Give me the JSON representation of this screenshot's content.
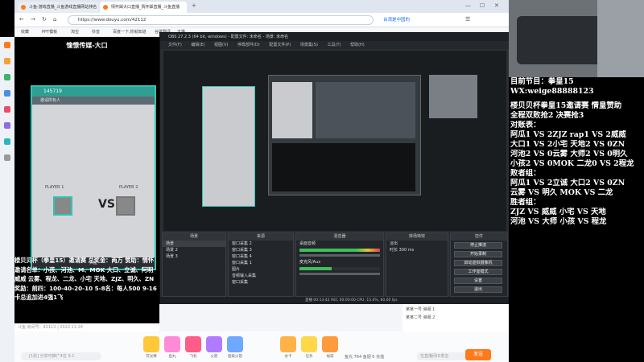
{
  "browser": {
    "tabs": [
      {
        "title": "斗鱼-游戏直播_斗鱼游戏直播网站排名"
      },
      {
        "title": "情怀踩大口直播_情怀踩直播_斗鱼直播"
      }
    ],
    "url": "https://www.douyu.com/42112",
    "security_text": "台湾是中国的",
    "bookmarks": [
      "收藏",
      "PPT模板",
      "淘宝",
      "抖音",
      "百度一下,你就知道",
      "谷歌翻译",
      "天猫"
    ]
  },
  "stream": {
    "title": "憧憬传媒-大口",
    "room_id": "145719",
    "room_sub": "邀请所有人",
    "player1": "PLAYER 1",
    "player2": "PLAYER 2",
    "vs": "VS",
    "footer": "入座",
    "overlay_lines": [
      "楼贝贝杯（拳皇15）邀请赛 总奖金：两万 赞助：情怀",
      "邀请名单：小孩、河池、M、MOK 大口、立诚、阿明",
      "威威 云雾、程龙、二龙、小宅 天地、ZJZ、明久、ZN",
      "奖励：前四：100-40-20-10 5-8名：每人500 9-16",
      "卡总追加进4强1飞"
    ],
    "info": "斗鱼 房间号：42112 | 2022.11.24"
  },
  "obs": {
    "title": "OBS 27.2.3 (64 bit, windows) - 配置文件: 未命名 - 场景: 未命名",
    "menu": [
      "文件(F)",
      "编辑(E)",
      "视图(V)",
      "停靠部件(D)",
      "配置文件(P)",
      "场景集(S)",
      "工具(T)",
      "帮助(H)"
    ],
    "columns": {
      "scenes": {
        "header": "场景",
        "items": [
          "场景",
          "场景 2",
          "场景 3"
        ]
      },
      "sources": {
        "header": "来源",
        "items": [
          "窗口采集 2",
          "窗口采集 3",
          "窗口采集 4",
          "窗口采集 1",
          "图片",
          "音频输入采集",
          "窗口采集"
        ]
      },
      "mixer": {
        "header": "混音器",
        "items": [
          "桌面音频",
          "麦克风/Aux"
        ]
      },
      "transitions": {
        "header": "转场特效",
        "items": [
          "淡出",
          "时长 300 ms"
        ]
      },
      "controls": {
        "header": "控件",
        "buttons": [
          "停止推流",
          "开始录制",
          "启动虚拟摄像机",
          "工作室模式",
          "设置",
          "退出"
        ]
      }
    },
    "source_bar": "来源筛选",
    "status": "直播 00:13:42   REC 00:00:00   CPU: 15.0%, 60.00 fps"
  },
  "giftbar": {
    "chat_placeholder": "[1张] 分享可推广4位 9.1",
    "send": "发送",
    "chat_hint": "在直播间ID…",
    "gifts": [
      "荧光棒",
      "鱼丸",
      "飞机",
      "火箭",
      "超级火箭",
      "办卡",
      "任务",
      "福袋"
    ],
    "balance": "鱼丸 764  鱼翅 0 充值"
  },
  "chat": {
    "lines": [
      "某某一号 弹幕 1",
      "某某二号 弹幕 2"
    ],
    "input_hint": "在直播间ID发言"
  },
  "right": {
    "lines": [
      "目前节目：拳皇15",
      "WX:weige88888123",
      "",
      "楼贝贝杯拳皇15邀请赛 情皇赞助",
      "全程双败抢2 决赛抢3",
      "对账表：",
      "阿瓜1 VS 2ZJZ  rap1 VS 2威威",
      "大口1 VS 2小宅 天地2 VS 0ZN",
      "河池2 VS 0云雾 大师2 VS 0明久",
      "小孩2 VS 0MOK  二龙0 VS 2程龙",
      "败者组：",
      "阿瓜1 VS 2立诚  大口2 VS 0ZN",
      "云雾 VS 明久  MOK  VS  二龙",
      "胜者组：",
      "ZJZ VS 威威  小宅 VS 天地",
      "河池 VS 大师  小孩 VS 程龙"
    ]
  }
}
